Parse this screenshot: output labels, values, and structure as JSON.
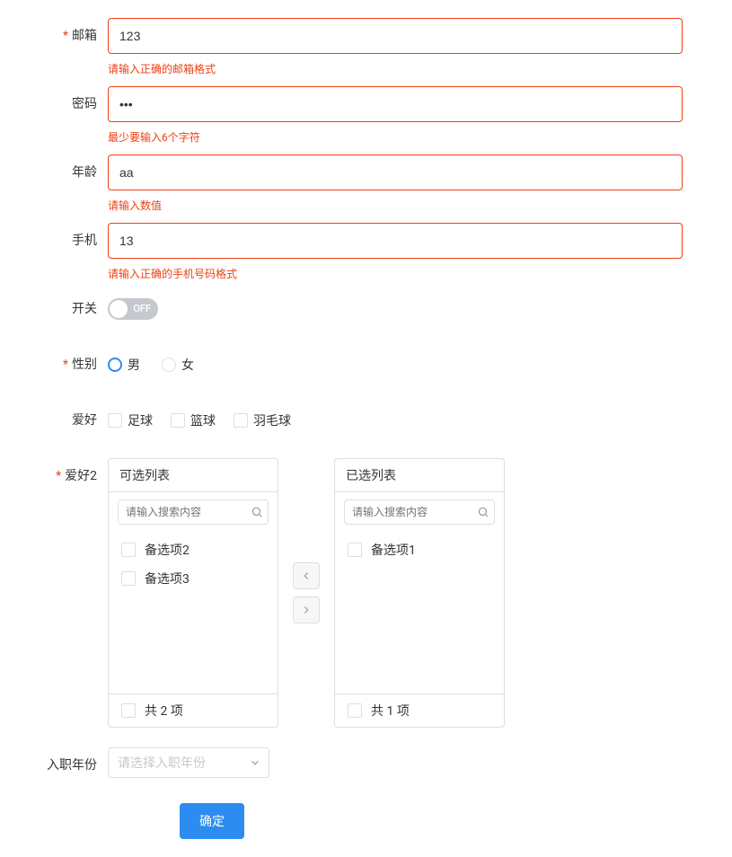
{
  "email": {
    "label": "邮箱",
    "required": true,
    "value": "123",
    "error": "请输入正确的邮箱格式"
  },
  "password": {
    "label": "密码",
    "required": false,
    "value": "•••",
    "error": "最少要输入6个字符"
  },
  "age": {
    "label": "年龄",
    "required": false,
    "value": "aa",
    "error": "请输入数值"
  },
  "phone": {
    "label": "手机",
    "required": false,
    "value": "13",
    "error": "请输入正确的手机号码格式"
  },
  "switch": {
    "label": "开关",
    "state": "OFF"
  },
  "gender": {
    "label": "性别",
    "required": true,
    "options": [
      "男",
      "女"
    ],
    "selected": "男"
  },
  "hobby": {
    "label": "爱好",
    "options": [
      "足球",
      "篮球",
      "羽毛球"
    ]
  },
  "hobby2": {
    "label": "爱好2",
    "required": true,
    "left": {
      "title": "可选列表",
      "search_placeholder": "请输入搜索内容",
      "items": [
        "备选项2",
        "备选项3"
      ],
      "footer": "共 2 项"
    },
    "right": {
      "title": "已选列表",
      "search_placeholder": "请输入搜索内容",
      "items": [
        "备选项1"
      ],
      "footer": "共 1 项"
    }
  },
  "year": {
    "label": "入职年份",
    "placeholder": "请选择入职年份"
  },
  "submit": {
    "label": "确定"
  }
}
